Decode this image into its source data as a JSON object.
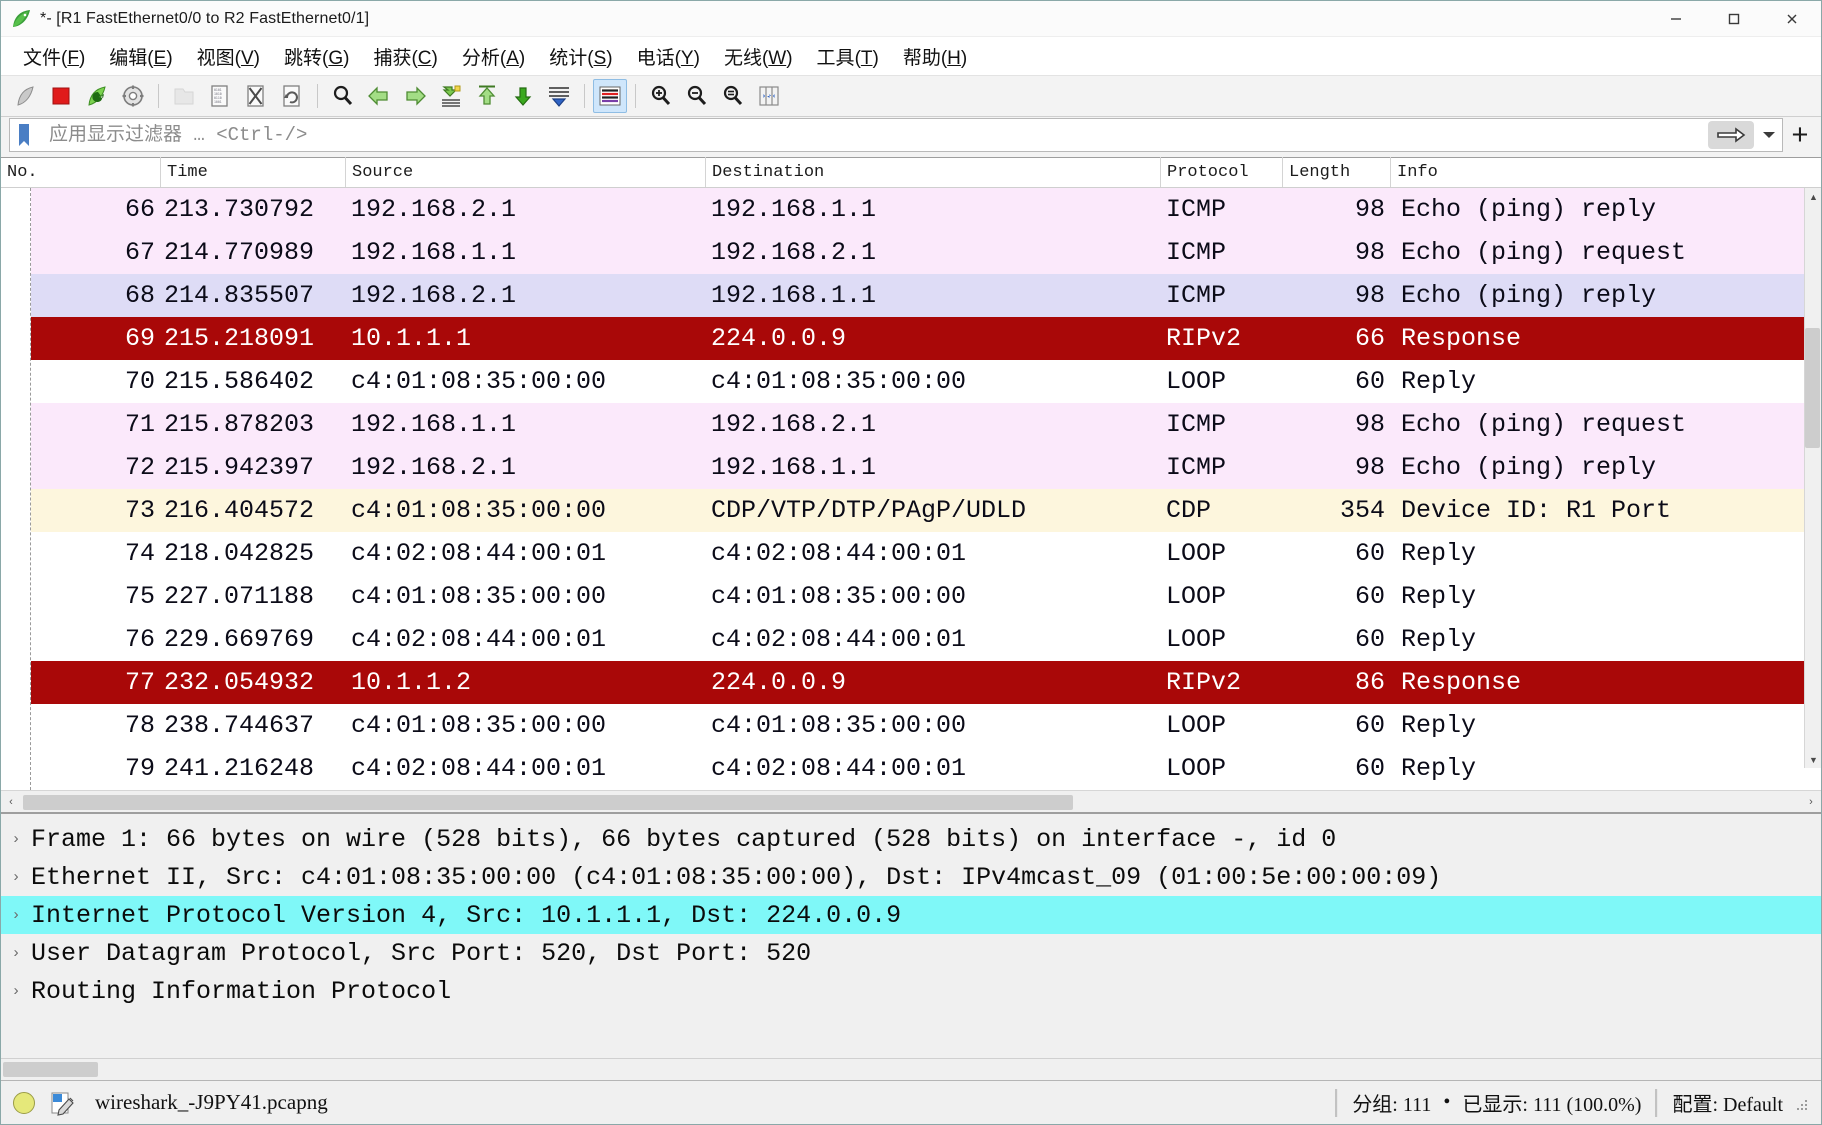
{
  "window": {
    "title": "*- [R1 FastEthernet0/0 to R2 FastEthernet0/1]",
    "minimize_label": "–",
    "maximize_label": "□",
    "close_label": "✕"
  },
  "menu": [
    {
      "label": "文件",
      "mnemonic": "F"
    },
    {
      "label": "编辑",
      "mnemonic": "E"
    },
    {
      "label": "视图",
      "mnemonic": "V"
    },
    {
      "label": "跳转",
      "mnemonic": "G"
    },
    {
      "label": "捕获",
      "mnemonic": "C"
    },
    {
      "label": "分析",
      "mnemonic": "A"
    },
    {
      "label": "统计",
      "mnemonic": "S"
    },
    {
      "label": "电话",
      "mnemonic": "Y"
    },
    {
      "label": "无线",
      "mnemonic": "W"
    },
    {
      "label": "工具",
      "mnemonic": "T"
    },
    {
      "label": "帮助",
      "mnemonic": "H"
    }
  ],
  "toolbar": {
    "items": [
      {
        "name": "start-capture-icon",
        "state": "enabled"
      },
      {
        "name": "stop-capture-icon",
        "state": "enabled"
      },
      {
        "name": "restart-capture-icon",
        "state": "enabled"
      },
      {
        "name": "capture-options-icon",
        "state": "enabled"
      },
      {
        "name": "open-file-icon",
        "state": "disabled"
      },
      {
        "name": "save-file-icon",
        "state": "enabled"
      },
      {
        "name": "close-file-icon",
        "state": "enabled"
      },
      {
        "name": "reload-file-icon",
        "state": "enabled"
      },
      {
        "name": "find-packet-icon",
        "state": "enabled"
      },
      {
        "name": "go-back-icon",
        "state": "enabled"
      },
      {
        "name": "go-forward-icon",
        "state": "enabled"
      },
      {
        "name": "go-to-packet-icon",
        "state": "enabled"
      },
      {
        "name": "go-to-first-packet-icon",
        "state": "enabled"
      },
      {
        "name": "go-to-last-packet-icon",
        "state": "enabled"
      },
      {
        "name": "auto-scroll-icon",
        "state": "enabled"
      },
      {
        "name": "colorize-packets-icon",
        "state": "active"
      },
      {
        "name": "zoom-in-icon",
        "state": "enabled"
      },
      {
        "name": "zoom-out-icon",
        "state": "enabled"
      },
      {
        "name": "normal-size-icon",
        "state": "enabled"
      },
      {
        "name": "resize-columns-icon",
        "state": "enabled"
      }
    ]
  },
  "filter": {
    "placeholder": "应用显示过滤器 … <Ctrl-/>",
    "value": "",
    "apply_label": "⟶",
    "dropdown_label": "▾",
    "add_label": "+"
  },
  "packet_list": {
    "columns": [
      {
        "key": "no",
        "label": "No."
      },
      {
        "key": "time",
        "label": "Time"
      },
      {
        "key": "src",
        "label": "Source"
      },
      {
        "key": "dst",
        "label": "Destination"
      },
      {
        "key": "proto",
        "label": "Protocol"
      },
      {
        "key": "len",
        "label": "Length"
      },
      {
        "key": "info",
        "label": "Info"
      }
    ],
    "rows": [
      {
        "no": "66",
        "time": "213.730792",
        "src": "192.168.2.1",
        "dst": "192.168.1.1",
        "proto": "ICMP",
        "len": "98",
        "info": "Echo (ping) reply",
        "bg": "#fbe9fb",
        "fg": "#0b0b18"
      },
      {
        "no": "67",
        "time": "214.770989",
        "src": "192.168.1.1",
        "dst": "192.168.2.1",
        "proto": "ICMP",
        "len": "98",
        "info": "Echo (ping) request",
        "bg": "#fbe9fb",
        "fg": "#0b0b18"
      },
      {
        "no": "68",
        "time": "214.835507",
        "src": "192.168.2.1",
        "dst": "192.168.1.1",
        "proto": "ICMP",
        "len": "98",
        "info": "Echo (ping) reply",
        "bg": "#dedcf6",
        "fg": "#0b0b18"
      },
      {
        "no": "69",
        "time": "215.218091",
        "src": "10.1.1.1",
        "dst": "224.0.0.9",
        "proto": "RIPv2",
        "len": "66",
        "info": "Response",
        "bg": "#a90808",
        "fg": "#ffffff"
      },
      {
        "no": "70",
        "time": "215.586402",
        "src": "c4:01:08:35:00:00",
        "dst": "c4:01:08:35:00:00",
        "proto": "LOOP",
        "len": "60",
        "info": "Reply",
        "bg": "#ffffff",
        "fg": "#0b0b18"
      },
      {
        "no": "71",
        "time": "215.878203",
        "src": "192.168.1.1",
        "dst": "192.168.2.1",
        "proto": "ICMP",
        "len": "98",
        "info": "Echo (ping) request",
        "bg": "#fbe9fb",
        "fg": "#0b0b18"
      },
      {
        "no": "72",
        "time": "215.942397",
        "src": "192.168.2.1",
        "dst": "192.168.1.1",
        "proto": "ICMP",
        "len": "98",
        "info": "Echo (ping) reply",
        "bg": "#fbe9fb",
        "fg": "#0b0b18"
      },
      {
        "no": "73",
        "time": "216.404572",
        "src": "c4:01:08:35:00:00",
        "dst": "CDP/VTP/DTP/PAgP/UDLD",
        "proto": "CDP",
        "len": "354",
        "info": "Device ID: R1  Port",
        "bg": "#fdf6dd",
        "fg": "#0b0b18"
      },
      {
        "no": "74",
        "time": "218.042825",
        "src": "c4:02:08:44:00:01",
        "dst": "c4:02:08:44:00:01",
        "proto": "LOOP",
        "len": "60",
        "info": "Reply",
        "bg": "#ffffff",
        "fg": "#0b0b18"
      },
      {
        "no": "75",
        "time": "227.071188",
        "src": "c4:01:08:35:00:00",
        "dst": "c4:01:08:35:00:00",
        "proto": "LOOP",
        "len": "60",
        "info": "Reply",
        "bg": "#ffffff",
        "fg": "#0b0b18"
      },
      {
        "no": "76",
        "time": "229.669769",
        "src": "c4:02:08:44:00:01",
        "dst": "c4:02:08:44:00:01",
        "proto": "LOOP",
        "len": "60",
        "info": "Reply",
        "bg": "#ffffff",
        "fg": "#0b0b18"
      },
      {
        "no": "77",
        "time": "232.054932",
        "src": "10.1.1.2",
        "dst": "224.0.0.9",
        "proto": "RIPv2",
        "len": "86",
        "info": "Response",
        "bg": "#a90808",
        "fg": "#ffffff"
      },
      {
        "no": "78",
        "time": "238.744637",
        "src": "c4:01:08:35:00:00",
        "dst": "c4:01:08:35:00:00",
        "proto": "LOOP",
        "len": "60",
        "info": "Reply",
        "bg": "#ffffff",
        "fg": "#0b0b18"
      },
      {
        "no": "79",
        "time": "241.216248",
        "src": "c4:02:08:44:00:01",
        "dst": "c4:02:08:44:00:01",
        "proto": "LOOP",
        "len": "60",
        "info": "Reply",
        "bg": "#ffffff",
        "fg": "#0b0b18"
      }
    ]
  },
  "packet_detail": {
    "rows": [
      {
        "text": "Frame 1: 66 bytes on wire (528 bits), 66 bytes captured (528 bits) on interface -, id 0",
        "selected": false
      },
      {
        "text": "Ethernet II, Src: c4:01:08:35:00:00 (c4:01:08:35:00:00), Dst: IPv4mcast_09 (01:00:5e:00:00:09)",
        "selected": false
      },
      {
        "text": "Internet Protocol Version 4, Src: 10.1.1.1, Dst: 224.0.0.9",
        "selected": true
      },
      {
        "text": "User Datagram Protocol, Src Port: 520, Dst Port: 520",
        "selected": false
      },
      {
        "text": "Routing Information Protocol",
        "selected": false
      }
    ],
    "expand_glyph": "›"
  },
  "statusbar": {
    "filename": "wireshark_-J9PY41.pcapng",
    "packets_label": "分组: 111",
    "separator_dot": "•",
    "displayed_label": "已显示: 111 (100.0%)",
    "profile_label": "配置: Default"
  },
  "colors": {
    "rip_row_bg": "#a90808",
    "icmp_row_bg": "#fbe9fb",
    "icmp_alt_row_bg": "#dedcf6",
    "cdp_row_bg": "#fdf6dd",
    "detail_selected_bg": "#7ff8f8",
    "toolbar_active_bg": "#cfe6fb"
  }
}
